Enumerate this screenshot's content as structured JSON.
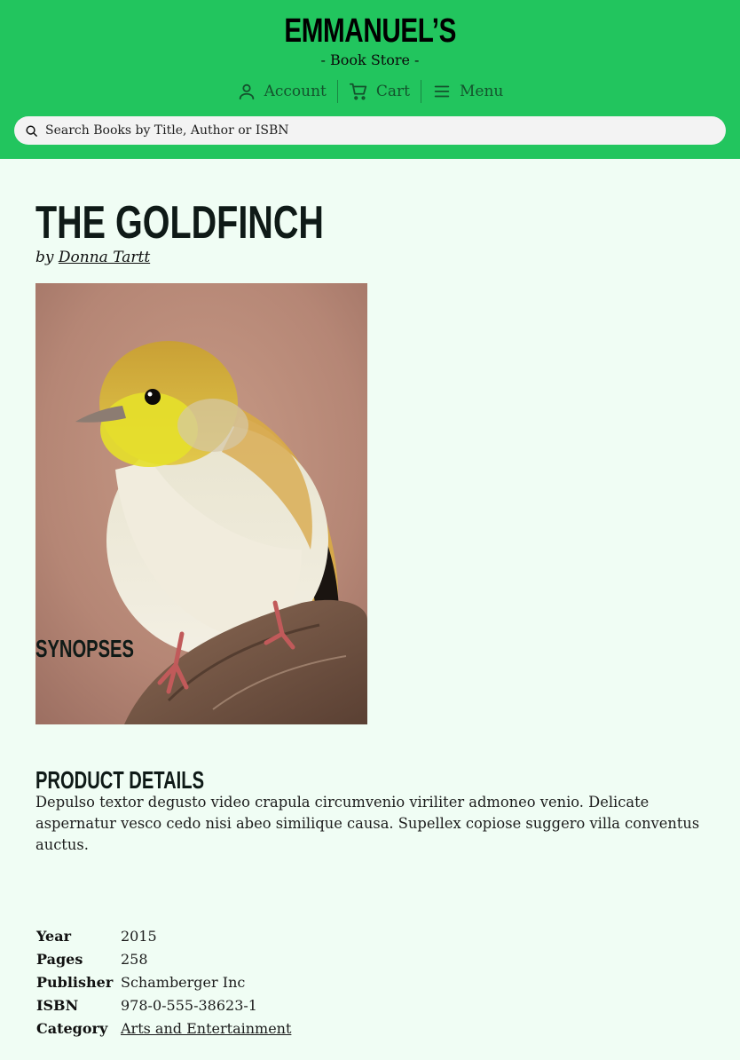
{
  "brand": {
    "name": "EMMANUEL’S",
    "subtitle": "- Book Store -"
  },
  "nav": {
    "account": "Account",
    "cart": "Cart",
    "menu": "Menu"
  },
  "search": {
    "placeholder": "Search Books by Title, Author or ISBN"
  },
  "book": {
    "title": "THE GOLDFINCH",
    "by": "by",
    "author": "Donna Tartt",
    "cover_icon": "goldfinch-bird-photo"
  },
  "synopsis": {
    "heading": "SYNOPSES",
    "text": "Depulso textor degusto video crapula circumvenio viriliter admoneo venio. Delicate aspernatur vesco cedo nisi abeo similique causa. Supellex copiose suggero villa conventus auctus."
  },
  "details": {
    "heading": "PRODUCT DETAILS",
    "rows": [
      {
        "label": "Year",
        "value": "2015"
      },
      {
        "label": "Pages",
        "value": "258"
      },
      {
        "label": "Publisher",
        "value": "Schamberger Inc"
      },
      {
        "label": "ISBN",
        "value": "978-0-555-38623-1"
      },
      {
        "label": "Category",
        "value": "Arts and Entertainment"
      }
    ]
  },
  "colors": {
    "header": "#22c55e",
    "page_bg": "#f0fdf4",
    "nav_text": "#14532d"
  }
}
